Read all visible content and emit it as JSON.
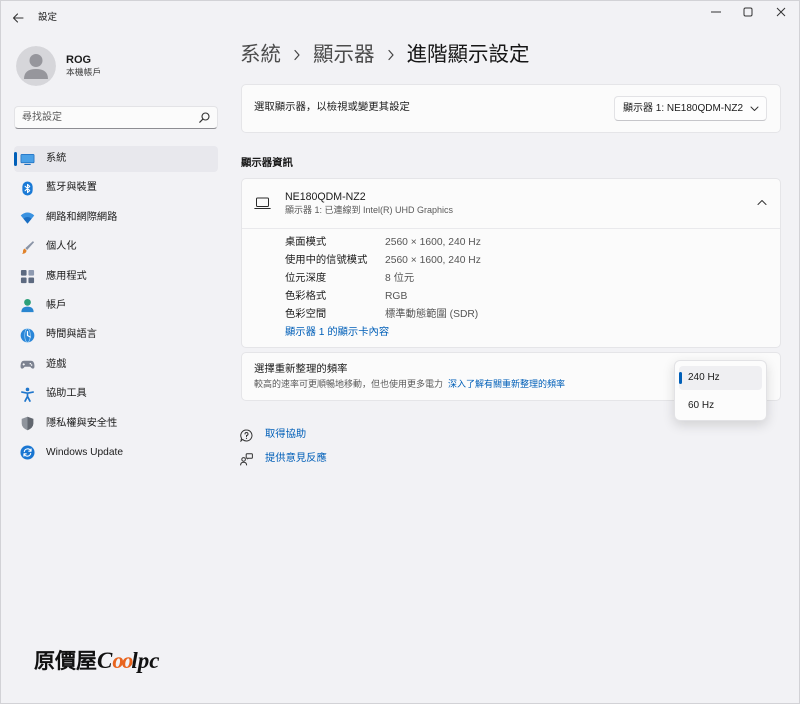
{
  "window": {
    "title": "設定"
  },
  "user": {
    "name": "ROG",
    "account_type": "本機帳戶"
  },
  "search": {
    "placeholder": "尋找設定"
  },
  "sidebar": {
    "items": [
      {
        "label": "系統",
        "icon": "system-icon",
        "selected": true
      },
      {
        "label": "藍牙與裝置",
        "icon": "bluetooth-icon",
        "selected": false
      },
      {
        "label": "網路和網際網路",
        "icon": "network-icon",
        "selected": false
      },
      {
        "label": "個人化",
        "icon": "personalization-icon",
        "selected": false
      },
      {
        "label": "應用程式",
        "icon": "apps-icon",
        "selected": false
      },
      {
        "label": "帳戶",
        "icon": "accounts-icon",
        "selected": false
      },
      {
        "label": "時間與語言",
        "icon": "time-language-icon",
        "selected": false
      },
      {
        "label": "遊戲",
        "icon": "gaming-icon",
        "selected": false
      },
      {
        "label": "協助工具",
        "icon": "accessibility-icon",
        "selected": false
      },
      {
        "label": "隱私權與安全性",
        "icon": "privacy-icon",
        "selected": false
      },
      {
        "label": "Windows Update",
        "icon": "windows-update-icon",
        "selected": false
      }
    ]
  },
  "breadcrumb": [
    {
      "label": "系統"
    },
    {
      "label": "顯示器"
    },
    {
      "label": "進階顯示設定"
    }
  ],
  "select_display": {
    "label": "選取顯示器，以檢視或變更其設定",
    "value": "顯示器 1: NE180QDM-NZ2"
  },
  "display_info": {
    "section_title": "顯示器資訊",
    "monitor_name": "NE180QDM-NZ2",
    "monitor_subtitle": "顯示器 1: 已連線到 Intel(R) UHD Graphics",
    "expanded": true,
    "rows": [
      {
        "label": "桌面模式",
        "value": "2560 × 1600, 240 Hz"
      },
      {
        "label": "使用中的信號模式",
        "value": "2560 × 1600, 240 Hz"
      },
      {
        "label": "位元深度",
        "value": "8 位元"
      },
      {
        "label": "色彩格式",
        "value": "RGB"
      },
      {
        "label": "色彩空間",
        "value": "標準動態範圍 (SDR)"
      }
    ],
    "adapter_link": "顯示器 1 的顯示卡內容"
  },
  "refresh_rate": {
    "title": "選擇重新整理的頻率",
    "description": "較高的速率可更順暢地移動，但也使用更多電力",
    "learn_more_link": "深入了解有關重新整理的頻率",
    "dropdown_open": true,
    "options": [
      {
        "label": "240 Hz",
        "selected": true
      },
      {
        "label": "60 Hz",
        "selected": false
      }
    ]
  },
  "help": {
    "get_help": "取得協助",
    "feedback": "提供意見反應"
  },
  "logo": {
    "chinese": "原價屋",
    "latin_c": "C",
    "latin_oo": "oo",
    "latin_lpc": "lpc"
  },
  "colors": {
    "accent": "#005fb8",
    "background": "#f2f2f5",
    "card": "#fbfbfb",
    "logo_highlight": "#e8641e"
  }
}
